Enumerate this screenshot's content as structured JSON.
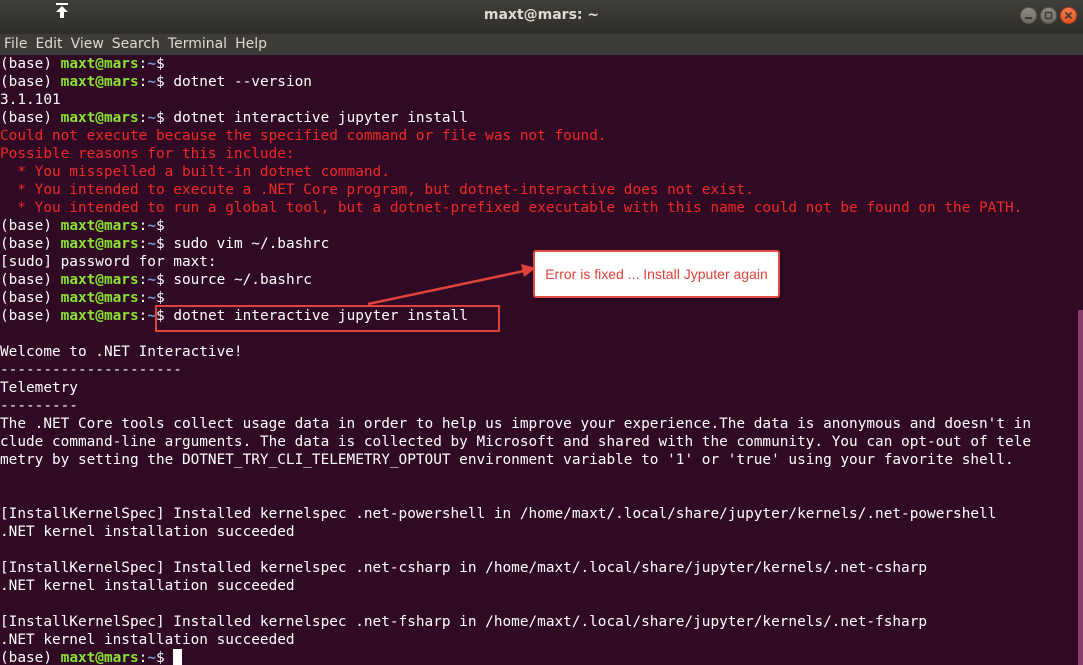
{
  "window": {
    "title": "maxt@mars: ~"
  },
  "menu": [
    "File",
    "Edit",
    "View",
    "Search",
    "Terminal",
    "Help"
  ],
  "prompt": {
    "env": "(base) ",
    "user": "maxt@mars",
    "sep": ":",
    "path": "~",
    "symbol": "$ "
  },
  "lines": [
    {
      "type": "prompt",
      "cmd": ""
    },
    {
      "type": "prompt",
      "cmd": "dotnet --version"
    },
    {
      "type": "out",
      "text": "3.1.101"
    },
    {
      "type": "prompt",
      "cmd": "dotnet interactive jupyter install"
    },
    {
      "type": "err",
      "text": "Could not execute because the specified command or file was not found."
    },
    {
      "type": "err",
      "text": "Possible reasons for this include:"
    },
    {
      "type": "err",
      "text": "  * You misspelled a built-in dotnet command."
    },
    {
      "type": "err",
      "text": "  * You intended to execute a .NET Core program, but dotnet-interactive does not exist."
    },
    {
      "type": "err",
      "text": "  * You intended to run a global tool, but a dotnet-prefixed executable with this name could not be found on the PATH."
    },
    {
      "type": "prompt",
      "cmd": ""
    },
    {
      "type": "prompt",
      "cmd": "sudo vim ~/.bashrc"
    },
    {
      "type": "out",
      "text": "[sudo] password for maxt:"
    },
    {
      "type": "prompt",
      "cmd": "source ~/.bashrc"
    },
    {
      "type": "prompt",
      "cmd": ""
    },
    {
      "type": "prompt",
      "cmd": "dotnet interactive jupyter install"
    },
    {
      "type": "out",
      "text": ""
    },
    {
      "type": "out",
      "text": "Welcome to .NET Interactive!"
    },
    {
      "type": "out",
      "text": "---------------------"
    },
    {
      "type": "out",
      "text": "Telemetry"
    },
    {
      "type": "out",
      "text": "---------"
    },
    {
      "type": "out",
      "text": "The .NET Core tools collect usage data in order to help us improve your experience.The data is anonymous and doesn't in"
    },
    {
      "type": "out",
      "text": "clude command-line arguments. The data is collected by Microsoft and shared with the community. You can opt-out of tele"
    },
    {
      "type": "out",
      "text": "metry by setting the DOTNET_TRY_CLI_TELEMETRY_OPTOUT environment variable to '1' or 'true' using your favorite shell."
    },
    {
      "type": "out",
      "text": ""
    },
    {
      "type": "out",
      "text": ""
    },
    {
      "type": "out",
      "text": "[InstallKernelSpec] Installed kernelspec .net-powershell in /home/maxt/.local/share/jupyter/kernels/.net-powershell"
    },
    {
      "type": "out",
      "text": ".NET kernel installation succeeded"
    },
    {
      "type": "out",
      "text": ""
    },
    {
      "type": "out",
      "text": "[InstallKernelSpec] Installed kernelspec .net-csharp in /home/maxt/.local/share/jupyter/kernels/.net-csharp"
    },
    {
      "type": "out",
      "text": ".NET kernel installation succeeded"
    },
    {
      "type": "out",
      "text": ""
    },
    {
      "type": "out",
      "text": "[InstallKernelSpec] Installed kernelspec .net-fsharp in /home/maxt/.local/share/jupyter/kernels/.net-fsharp"
    },
    {
      "type": "out",
      "text": ".NET kernel installation succeeded"
    },
    {
      "type": "prompt",
      "cmd": "",
      "cursor": true
    }
  ],
  "annotation": {
    "text": "Error is fixed ... Install Jyputer again"
  },
  "colors": {
    "background": "#300a24",
    "prompt_user": "#8ae234",
    "prompt_path": "#729fcf",
    "error": "#ef2929",
    "annotation": "#e0423b"
  }
}
